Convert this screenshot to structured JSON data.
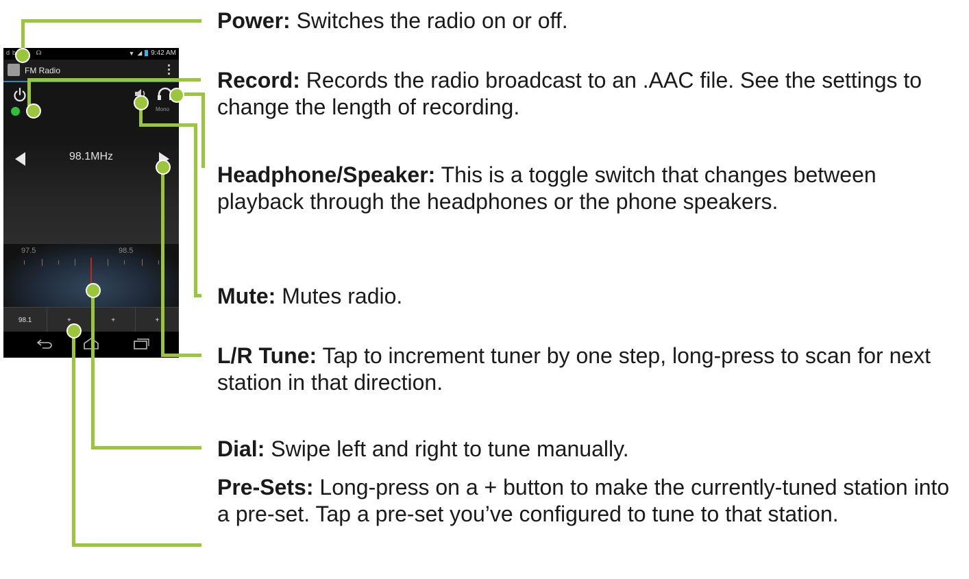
{
  "status_bar": {
    "left_icons": "db ▣ ☊",
    "time": "9:42 AM"
  },
  "app": {
    "title": "FM Radio"
  },
  "radio": {
    "mono_label": "Mono",
    "frequency": "98.1MHz",
    "dial_low": "97.5",
    "dial_high": "98.5",
    "presets": [
      "98.1",
      "+",
      "+",
      "+"
    ]
  },
  "icons": {
    "power": "power-icon",
    "record": "record-dot",
    "mute": "speaker-icon",
    "headphone": "headphone-icon",
    "left": "left-arrow",
    "right": "right-arrow"
  },
  "colors": {
    "accent": "#9bc63b",
    "record": "#2fbf3a",
    "needle": "#c02818",
    "actionbar_line": "#2a8dbd"
  },
  "annotations": [
    {
      "title": "Power:",
      "text": "Switches the radio on or off."
    },
    {
      "title": "Record:",
      "text": "Records the radio broadcast to an .AAC file.  See the settings to change the length of recording."
    },
    {
      "title": "Headphone/Speaker:",
      "text": "This is a toggle switch that changes between playback through the headphones or the phone speakers."
    },
    {
      "title": "Mute:",
      "text": "Mutes radio."
    },
    {
      "title": "L/R Tune:",
      "text": "Tap to increment tuner by one step, long-press to scan for next station in that direction."
    },
    {
      "title": "Dial:",
      "text": "Swipe left and right to tune manually."
    },
    {
      "title": "Pre-Sets:",
      "text": "Long-press on a + button to make the currently-tuned station into a pre-set.  Tap a pre-set you’ve configured to tune to that station."
    }
  ]
}
